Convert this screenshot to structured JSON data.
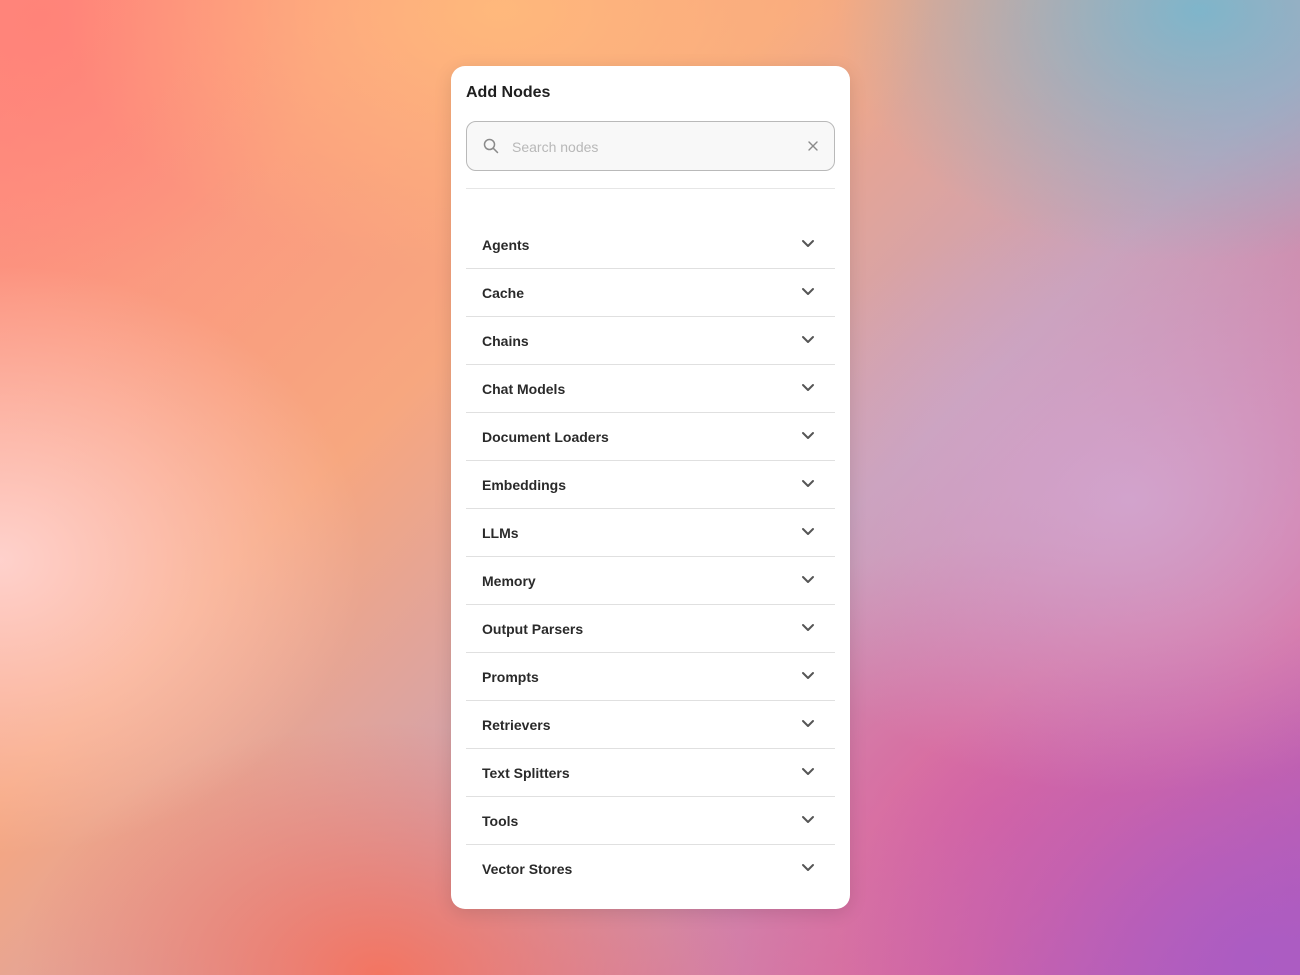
{
  "panel": {
    "title": "Add Nodes"
  },
  "search": {
    "placeholder": "Search nodes",
    "value": ""
  },
  "categories": [
    {
      "label": "Agents"
    },
    {
      "label": "Cache"
    },
    {
      "label": "Chains"
    },
    {
      "label": "Chat Models"
    },
    {
      "label": "Document Loaders"
    },
    {
      "label": "Embeddings"
    },
    {
      "label": "LLMs"
    },
    {
      "label": "Memory"
    },
    {
      "label": "Output Parsers"
    },
    {
      "label": "Prompts"
    },
    {
      "label": "Retrievers"
    },
    {
      "label": "Text Splitters"
    },
    {
      "label": "Tools"
    },
    {
      "label": "Vector Stores"
    }
  ],
  "icons": {
    "search": "search-icon",
    "clear": "close-icon",
    "expand": "chevron-down-icon"
  },
  "colors": {
    "panel_bg": "#ffffff",
    "text": "#2a2a2a",
    "icon": "#555555"
  }
}
